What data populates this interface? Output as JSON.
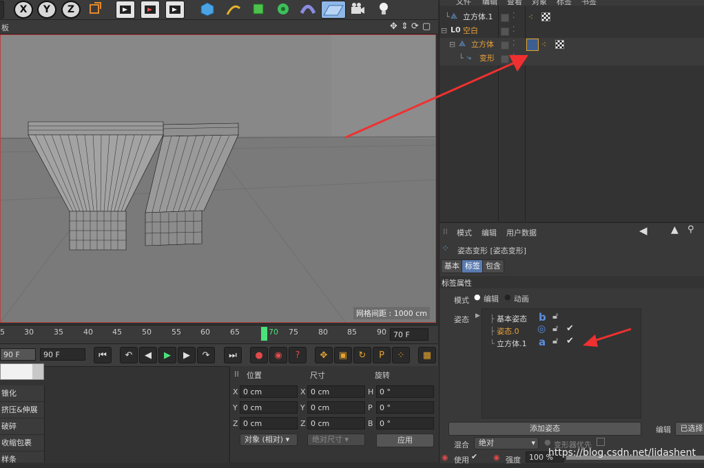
{
  "toolbar": {
    "axis_buttons": [
      "X",
      "Y",
      "Z"
    ]
  },
  "viewport": {
    "header_label": "板",
    "grid_label": "网格间距 : 1000 cm"
  },
  "timeline": {
    "ticks": [
      "5",
      "30",
      "35",
      "40",
      "45",
      "50",
      "55",
      "60",
      "65",
      "70",
      "75",
      "80",
      "85",
      "90"
    ],
    "current_frame": "70",
    "end_field": "70 F"
  },
  "transport": {
    "start_field": "90 F",
    "end_field": "90 F"
  },
  "menu": {
    "items": [
      "锥化",
      "挤压&伸展",
      "破碎",
      "收缩包裹",
      "样条"
    ]
  },
  "coord": {
    "headers": [
      "位置",
      "尺寸",
      "旋转"
    ],
    "rows": [
      {
        "a": "X",
        "av": "0 cm",
        "b": "X",
        "bv": "0 cm",
        "c": "H",
        "cv": "0 °"
      },
      {
        "a": "Y",
        "av": "0 cm",
        "b": "Y",
        "bv": "0 cm",
        "c": "P",
        "cv": "0 °"
      },
      {
        "a": "Z",
        "av": "0 cm",
        "b": "Z",
        "bv": "0 cm",
        "c": "B",
        "cv": "0 °"
      }
    ],
    "mode_dropdown": "对象 (相对)",
    "size_dropdown": "绝对尺寸",
    "apply": "应用"
  },
  "object_manager": {
    "menu": [
      "文件",
      "编辑",
      "查看",
      "对象",
      "标签",
      "书签"
    ],
    "rows": [
      {
        "name": "立方体.1",
        "color": "#e0e0e0"
      },
      {
        "name": "空白",
        "color": "#e8a23a"
      },
      {
        "name": "立方体",
        "color": "#e8a23a"
      },
      {
        "name": "变形",
        "color": "#e8a23a"
      }
    ]
  },
  "attribute_manager": {
    "menu": [
      "模式",
      "编辑",
      "用户数据"
    ],
    "title": "姿态变形 [姿态变形]",
    "tabs": [
      "基本",
      "标签",
      "包含"
    ],
    "section": "标签属性",
    "mode_label": "模式",
    "mode_options": [
      "编辑",
      "动画"
    ],
    "pose_label": "姿态",
    "poses": [
      {
        "name": "基本姿态",
        "color": "#d8d8d8",
        "icon": "b"
      },
      {
        "name": "姿态.0",
        "color": "#e8a23a",
        "icon": "◎"
      },
      {
        "name": "立方体.1",
        "color": "#d8d8d8",
        "icon": "a"
      }
    ],
    "add_pose": "添加姿态",
    "edit_label": "编辑",
    "selected_btn": "已选择",
    "blend_label": "混合",
    "blend_value": "绝对",
    "deformer_label": "变形器优先",
    "use_label": "使用",
    "strength_label": "强度",
    "strength_value": "100 %"
  },
  "watermark": "https://blog.csdn.net/lidashent"
}
